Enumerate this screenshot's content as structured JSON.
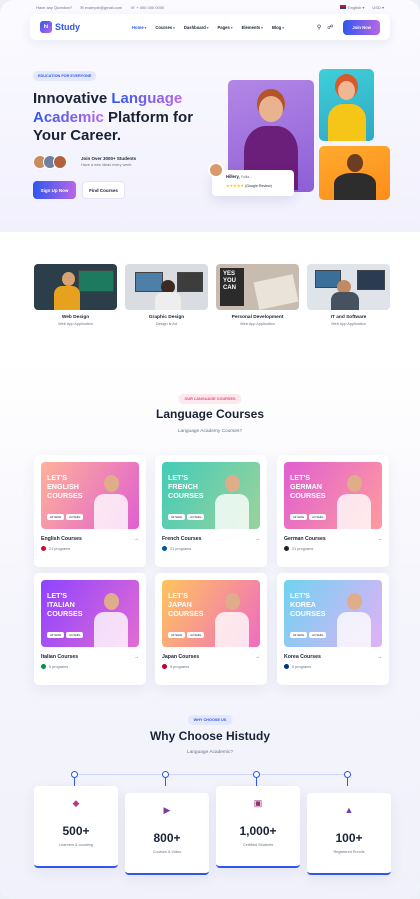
{
  "topbar": {
    "question": "Have any Question?",
    "email": "example@gmail.com",
    "phone": "+ 000 000 0000",
    "language": "English",
    "currency": "USD"
  },
  "nav": {
    "logo_text": "Study",
    "logo_mark": "hi",
    "menu": [
      "Home",
      "Courses",
      "Dashboard",
      "Pages",
      "Elements",
      "Blog"
    ],
    "join_label": "Join Now"
  },
  "hero": {
    "badge": "EDUCATION FOR EVERYONE",
    "title_1": "Innovative ",
    "title_hl_1": "Language",
    "title_hl_2": "Academic",
    "title_2": " Platform for Your Career.",
    "students_title": "Join Over 3000+ Students",
    "students_sub": "Have a new ideas every week",
    "signup_label": "Sign Up Now",
    "find_label": "Find Courses",
    "review_name": "Hillery,",
    "review_loc": "Fullla...",
    "review_stars": "★★★★★",
    "review_source": "(Google Review)"
  },
  "categories": [
    {
      "title": "Web Design",
      "subtitle": "Web App Application"
    },
    {
      "title": "Graphic Design",
      "subtitle": "Design is Art"
    },
    {
      "title": "Personal Development",
      "subtitle": "Web App Application"
    },
    {
      "title": "IT and Software",
      "subtitle": "Web App Application"
    }
  ],
  "courses_section": {
    "badge": "OUR LANGUAGE COURSES",
    "title": "Language Courses",
    "subtitle": "Language Academy Courses?",
    "lets": "LET'S",
    "word": "COURSES",
    "tag_1": "All Skills",
    "tag_2": "All Skills",
    "arrow": "→",
    "items": [
      {
        "lang": "ENGLISH",
        "name": "English Courses",
        "programs": "21 programs",
        "color_a": "#ffb199",
        "color_b": "#e05fd1",
        "flag": "#c8102e"
      },
      {
        "lang": "FRENCH",
        "name": "French Courses",
        "programs": "21 programs",
        "color_a": "#43cbb8",
        "color_b": "#9ad39b",
        "flag": "#0055a4"
      },
      {
        "lang": "GERMAN",
        "name": "German Courses",
        "programs": "21 programs",
        "color_a": "#e05fd1",
        "color_b": "#ff9a9e",
        "flag": "#222222"
      },
      {
        "lang": "ITALIAN",
        "name": "Italian Courses",
        "programs": "5 programs",
        "color_a": "#8e44ff",
        "color_b": "#e36bd3",
        "flag": "#009246"
      },
      {
        "lang": "JAPAN",
        "name": "Japan Courses",
        "programs": "5 programs",
        "color_a": "#ffc45d",
        "color_b": "#f06cc0",
        "flag": "#bc002d"
      },
      {
        "lang": "KOREA",
        "name": "Korea Courses",
        "programs": "5 programs",
        "color_a": "#6fd3f0",
        "color_b": "#e2b0f7",
        "flag": "#003478"
      }
    ]
  },
  "why_section": {
    "badge": "WHY CHOOSE US",
    "title": "Why Choose Histudy",
    "subtitle": "Language Academic?",
    "stats": [
      {
        "value": "500+",
        "label": "Learners & counting",
        "icon": "graduation-icon",
        "color": "#b13e88"
      },
      {
        "value": "800+",
        "label": "Courses & Video",
        "icon": "video-icon",
        "color": "#7b3aa6"
      },
      {
        "value": "1,000+",
        "label": "Certified Students",
        "icon": "certificate-icon",
        "color": "#8e2f74"
      },
      {
        "value": "100+",
        "label": "Registered Enrolls",
        "icon": "enroll-icon",
        "color": "#6a3fb8"
      }
    ]
  }
}
